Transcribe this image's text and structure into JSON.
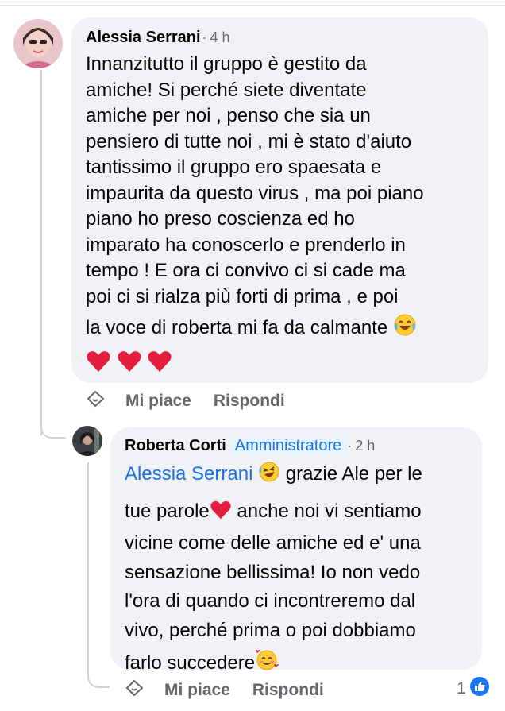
{
  "comment": {
    "author": "Alessia Serrani",
    "time": "4 h",
    "text_lines": [
      "Innanzitutto il gruppo è gestito da",
      "amiche!  Si perché siete diventate",
      "amiche per noi , penso che sia un",
      "pensiero di tutte noi , mi è stato d'aiuto",
      "tantissimo il gruppo ero spaesata e",
      "impaurita da questo virus , ma poi piano",
      "piano ho preso coscienza ed ho",
      "imparato ha conoscerlo e prenderlo in",
      "tempo !  E ora ci convivo ci si cade ma",
      "poi ci si rialza più forti di prima ,    e poi",
      "la voce di roberta mi fa da calmante"
    ],
    "emoji_end": "laughing-tears-emoji",
    "hearts_count": 3,
    "actions": {
      "like": "Mi piace",
      "reply": "Rispondi"
    }
  },
  "reply": {
    "author": "Roberta Corti",
    "badge": "Amministratore",
    "time": "2 h",
    "mention": "Alessia Serrani",
    "line1_after_mention": " grazie Ale per le",
    "line2_before_heart": "tue parole",
    "line2_after_heart": " anche noi vi sentiamo",
    "text_lines": [
      "vicine come delle amiche ed e' una",
      "sensazione bellissima! Io non vedo",
      "l'ora di quando ci incontreremo dal",
      "vivo, perché prima o poi dobbiamo"
    ],
    "last_line": "farlo succedere",
    "actions": {
      "like": "Mi piace",
      "reply": "Rispondi"
    },
    "reaction_count": "1"
  },
  "separator": "·",
  "colors": {
    "bubble": "#f0f2f5",
    "accent": "#1b74e4",
    "muted": "#65676b",
    "heart": "#e41e3f"
  }
}
